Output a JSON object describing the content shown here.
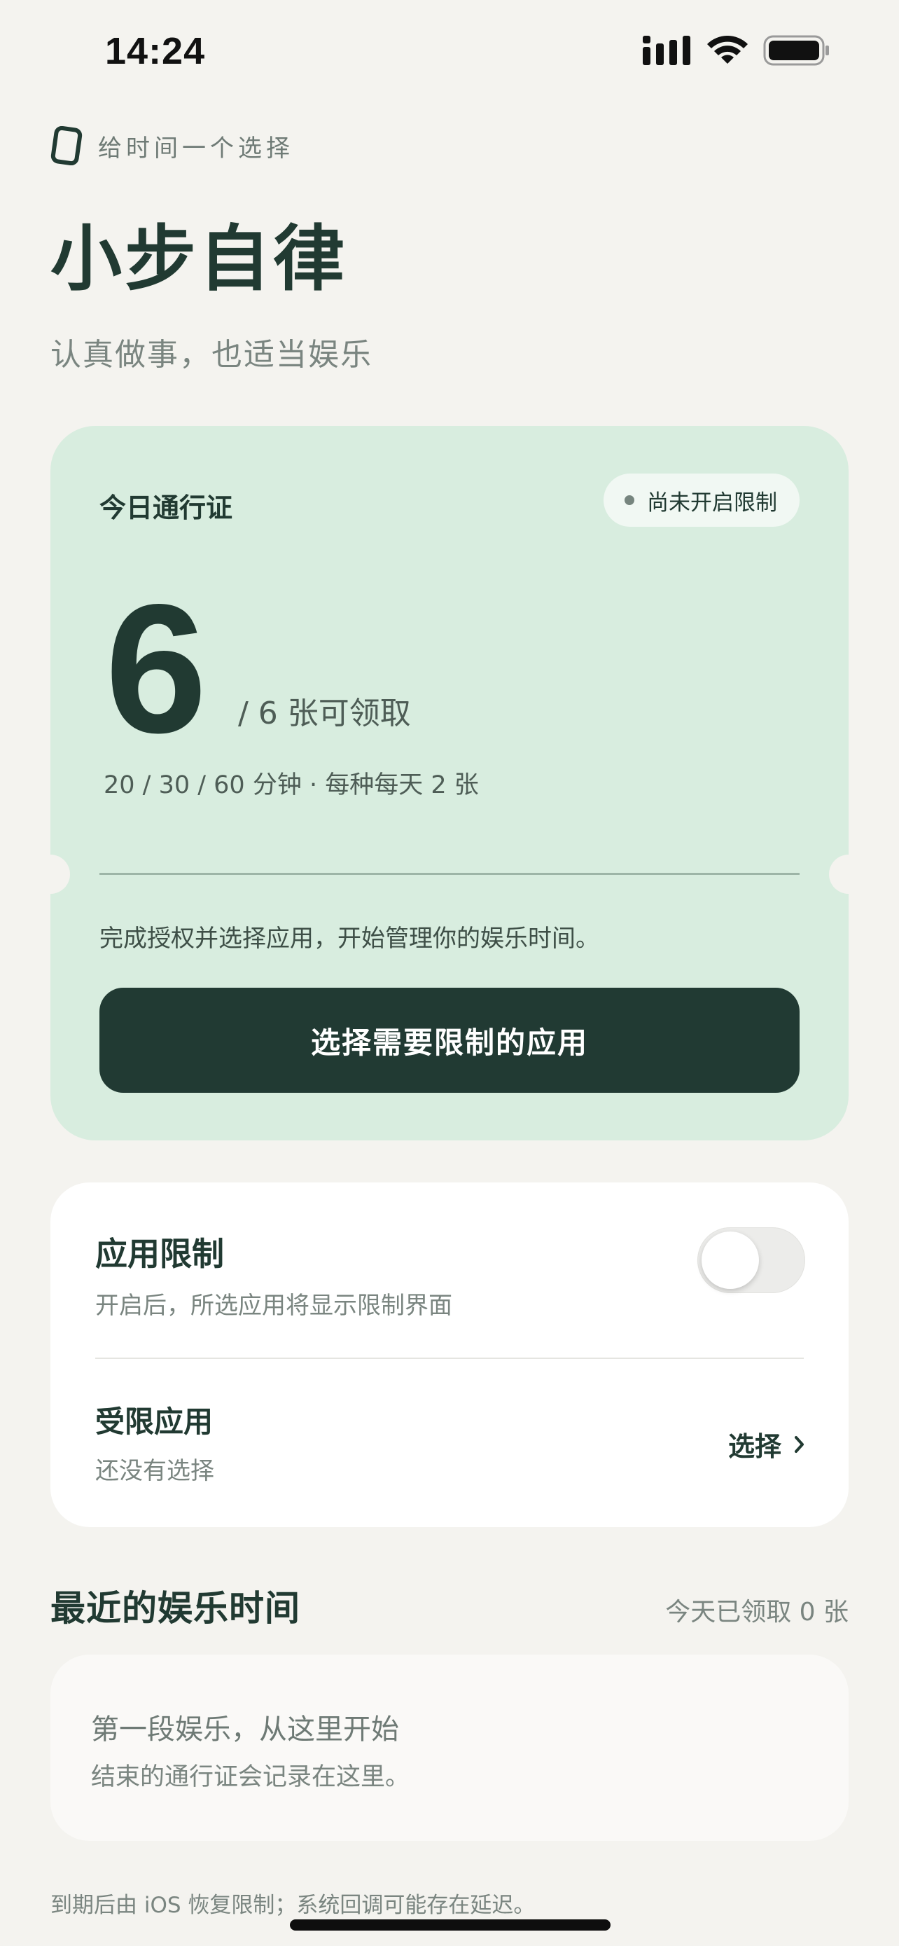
{
  "status_bar": {
    "time": "14:24",
    "icons": [
      "cellular-signal-icon",
      "wifi-icon",
      "battery-icon"
    ]
  },
  "header": {
    "tagline": "给时间一个选择",
    "title": "小步自律",
    "subtitle": "认真做事，也适当娱乐"
  },
  "pass_card": {
    "label": "今日通行证",
    "status_pill": "尚未开启限制",
    "available_count": "6",
    "total_text": "/ 6 张可领取",
    "detail": "20 / 30 / 60 分钟 · 每种每天 2 张",
    "hint": "完成授权并选择应用，开始管理你的娱乐时间。",
    "primary_button": "选择需要限制的应用"
  },
  "settings": {
    "app_limit": {
      "title": "应用限制",
      "description": "开启后，所选应用将显示限制界面",
      "enabled": false
    },
    "restricted_apps": {
      "title": "受限应用",
      "value": "还没有选择",
      "action": "选择"
    }
  },
  "recent": {
    "title": "最近的娱乐时间",
    "count_text": "今天已领取 0 张",
    "empty_title": "第一段娱乐，从这里开始",
    "empty_description": "结束的通行证会记录在这里。"
  },
  "footer": {
    "note": "到期后由 iOS 恢复限制；系统回调可能存在延迟。"
  },
  "colors": {
    "background": "#F4F3EF",
    "primary": "#213A33",
    "pass_card": "#D8EDDF",
    "muted_text": "#7A8580"
  }
}
